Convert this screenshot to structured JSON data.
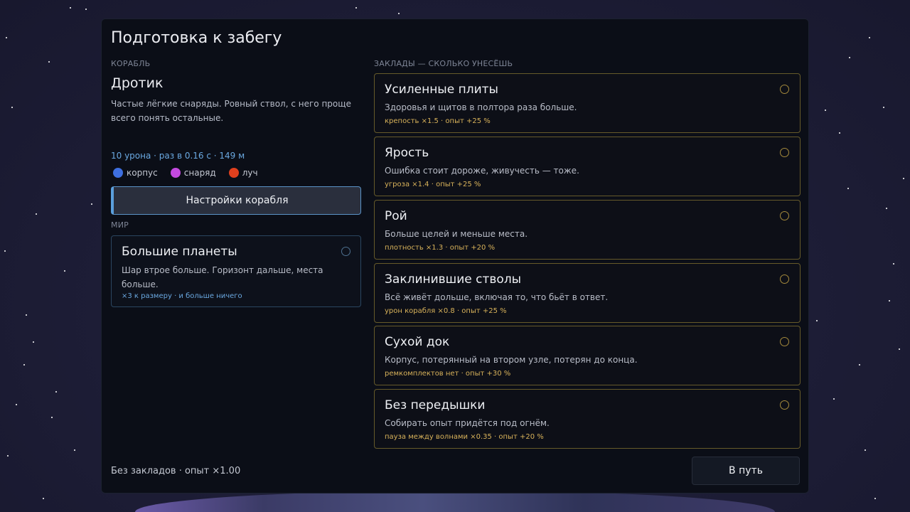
{
  "title": "Подготовка к забегу",
  "ship": {
    "section_label": "КОРАБЛЬ",
    "name": "Дротик",
    "description": "Частые лёгкие снаряды. Ровный ствол, с него проще всего понять остальные.",
    "stats": "10 урона · раз в 0.16 с · 149 м",
    "legend": [
      {
        "label": "корпус",
        "color": "#3e6fe0"
      },
      {
        "label": "снаряд",
        "color": "#c44ae0"
      },
      {
        "label": "луч",
        "color": "#e0401e"
      }
    ],
    "settings_label": "Настройки корабля"
  },
  "world": {
    "section_label": "МИР",
    "card": {
      "title": "Большие планеты",
      "description": "Шар втрое больше. Горизонт дальше, места больше.",
      "modifier": "×3 к размеру · и больше ничего"
    }
  },
  "stakes": {
    "section_label": "ЗАКЛАДЫ — СКОЛЬКО УНЕСЁШЬ",
    "cards": [
      {
        "title": "Усиленные плиты",
        "description": "Здоровья и щитов в полтора раза больше.",
        "modifier": "крепость ×1.5 · опыт +25 %"
      },
      {
        "title": "Ярость",
        "description": "Ошибка стоит дороже, живучесть — тоже.",
        "modifier": "угроза ×1.4 · опыт +25 %"
      },
      {
        "title": "Рой",
        "description": "Больше целей и меньше места.",
        "modifier": "плотность ×1.3 · опыт +20 %"
      },
      {
        "title": "Заклинившие стволы",
        "description": "Всё живёт дольше, включая то, что бьёт в ответ.",
        "modifier": "урон корабля ×0.8 · опыт +25 %"
      },
      {
        "title": "Сухой док",
        "description": "Корпус, потерянный на втором узле, потерян до конца.",
        "modifier": "ремкомплектов нет · опыт +30 %"
      },
      {
        "title": "Без передышки",
        "description": "Собирать опыт придётся под огнём.",
        "modifier": "пауза между волнами ×0.35 · опыт +20 %"
      }
    ]
  },
  "footer": {
    "summary": "Без закладов · опыт ×1.00",
    "go_label": "В путь"
  }
}
